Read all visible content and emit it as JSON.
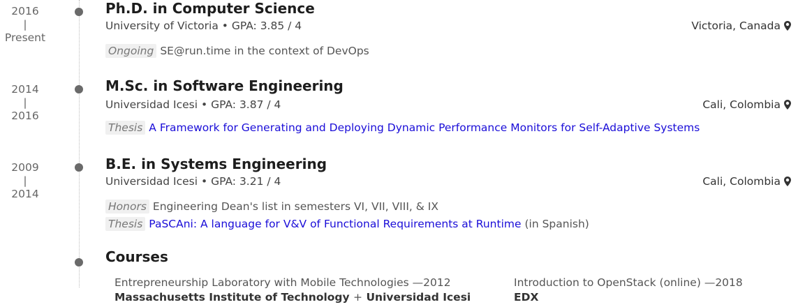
{
  "entries": [
    {
      "date_start": "2016",
      "date_sep": "|",
      "date_end": "Present",
      "degree": "Ph.D. in Computer Science",
      "institution": "University of Victoria",
      "gpa": "GPA: 3.85 / 4",
      "location": "Victoria, Canada",
      "notes": [
        {
          "tag": "Ongoing",
          "text": "SE@run.time in the context of DevOps"
        }
      ]
    },
    {
      "date_start": "2014",
      "date_sep": "|",
      "date_end": "2016",
      "degree": "M.Sc. in Software Engineering",
      "institution": "Universidad Icesi",
      "gpa": "GPA: 3.87 / 4",
      "location": "Cali, Colombia",
      "notes": [
        {
          "tag": "Thesis",
          "link": "A Framework for Generating and Deploying Dynamic Performance Monitors for Self-Adaptive Systems"
        }
      ]
    },
    {
      "date_start": "2009",
      "date_sep": "|",
      "date_end": "2014",
      "degree": "B.E. in Systems Engineering",
      "institution": "Universidad Icesi",
      "gpa": "GPA: 3.21 / 4",
      "location": "Cali, Colombia",
      "notes": [
        {
          "tag": "Honors",
          "text": "Engineering Dean's list in semesters VI, VII, VIII, & IX"
        },
        {
          "tag": "Thesis",
          "link": "PaSCAni: A language for V&V of Functional Requirements at Runtime",
          "suffix": "(in Spanish)"
        }
      ]
    }
  ],
  "separator": "•",
  "courses": {
    "heading": "Courses",
    "items": [
      {
        "title": "Entrepreneurship Laboratory with Mobile Technologies —2012",
        "org1": "Massachusetts Institute of Technology",
        "plus": "+",
        "org2": "Universidad Icesi"
      },
      {
        "title": "Introduction to OpenStack (online) —2018",
        "org1": "EDX"
      }
    ]
  },
  "colors": {
    "link": "#1a0dd8",
    "dot": "#6a6a6a"
  },
  "icons": {
    "location": "map-marker-icon"
  }
}
